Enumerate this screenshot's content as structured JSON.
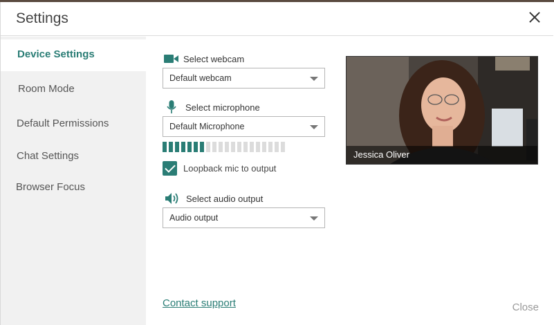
{
  "dialog": {
    "title": "Settings"
  },
  "sidebar": {
    "items": [
      {
        "label": "Device Settings",
        "active": true
      },
      {
        "label": "Room Mode",
        "active": false
      },
      {
        "label": "Default Permissions",
        "active": false
      },
      {
        "label": "Chat Settings",
        "active": false
      },
      {
        "label": "Browser Focus",
        "active": false
      }
    ]
  },
  "devices": {
    "webcam": {
      "label": "Select webcam",
      "value": "Default webcam",
      "icon": "video-camera-icon"
    },
    "microphone": {
      "label": "Select microphone",
      "value": "Default Microphone",
      "icon": "microphone-icon"
    },
    "mic_level": {
      "active_segments": 7,
      "total_segments": 20
    },
    "loopback": {
      "label": "Loopback mic to output",
      "checked": true
    },
    "audio_output": {
      "label": "Select audio output",
      "value": "Audio output",
      "icon": "speaker-icon"
    }
  },
  "preview": {
    "name": "Jessica Oliver"
  },
  "footer": {
    "support_link": "Contact support",
    "close_label": "Close"
  },
  "colors": {
    "accent": "#2a7d75",
    "sidebar_bg": "#f1f1f1"
  }
}
